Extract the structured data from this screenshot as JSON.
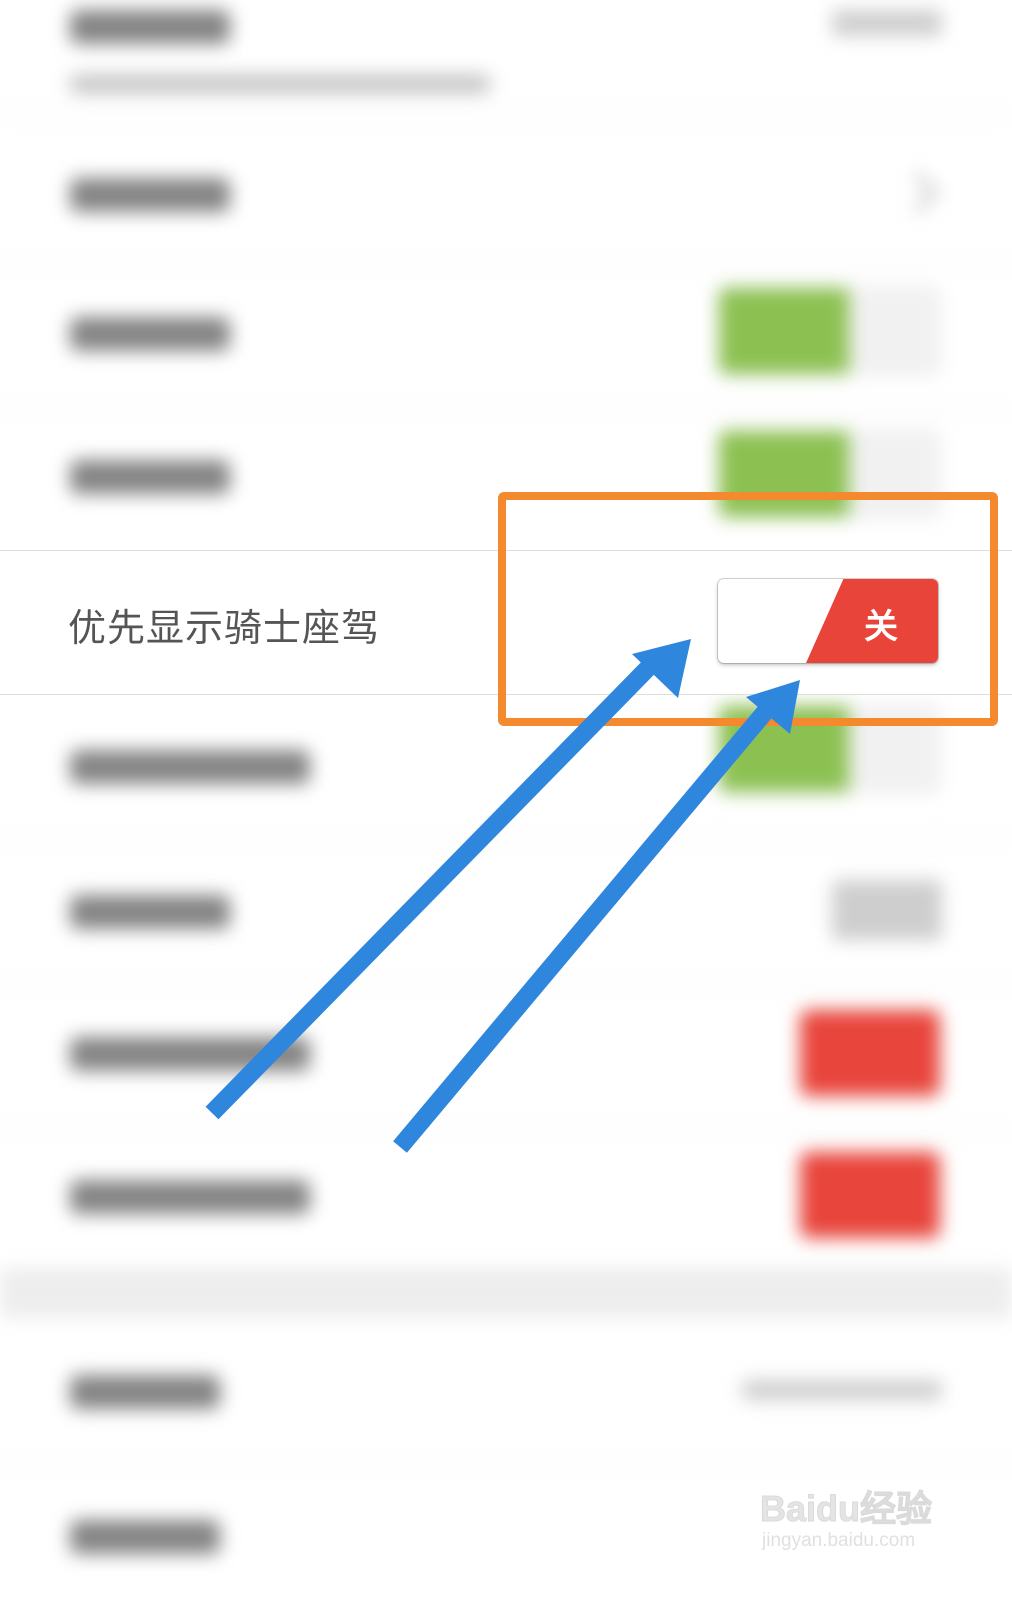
{
  "focused_setting": {
    "label": "优先显示骑士座驾",
    "toggle_state_text": "关"
  },
  "blurred_rows": [
    {
      "type": "text-with-subtitle"
    },
    {
      "type": "text-with-chevron"
    },
    {
      "type": "toggle",
      "state": "on"
    },
    {
      "type": "toggle",
      "state": "on"
    },
    {
      "type": "toggle",
      "state": "on"
    },
    {
      "type": "text-with-value"
    },
    {
      "type": "toggle",
      "state": "off"
    },
    {
      "type": "toggle",
      "state": "off"
    },
    {
      "type": "text-with-value"
    },
    {
      "type": "text"
    }
  ],
  "annotations": {
    "highlight_color": "#f5892e",
    "arrow_color": "#2f86dd",
    "arrow_count": 2
  },
  "colors": {
    "toggle_off": "#e8443a",
    "toggle_on": "#8cc152"
  },
  "watermark": {
    "logo": "Baidu经验",
    "url": "jingyan.baidu.com"
  }
}
